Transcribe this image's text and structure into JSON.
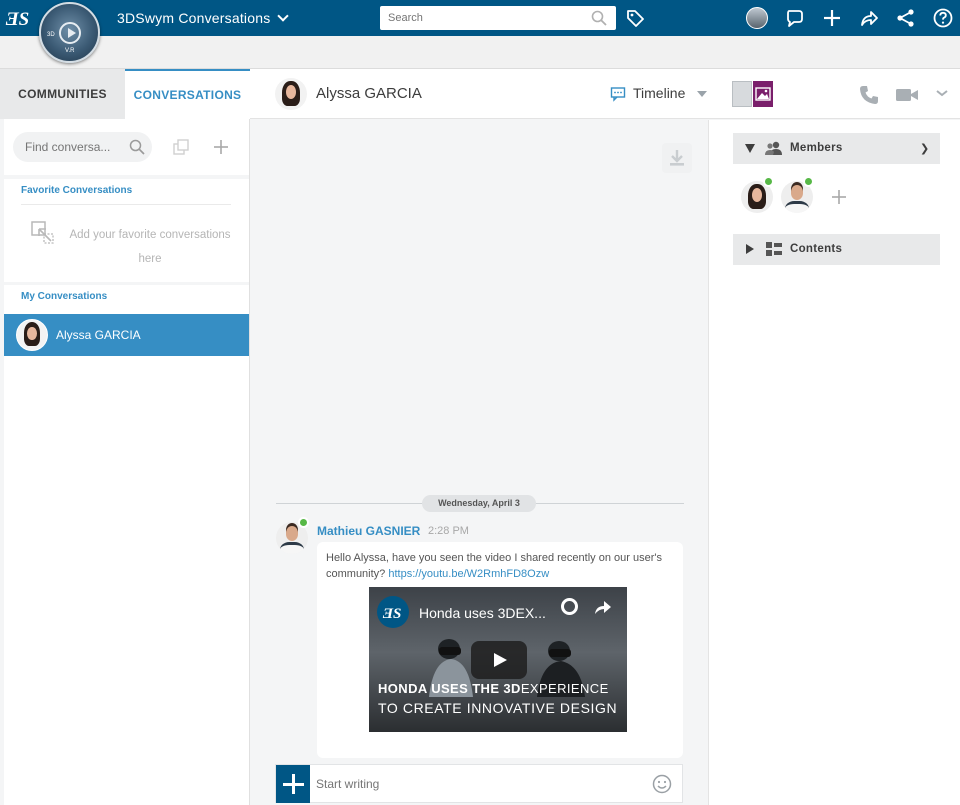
{
  "topbar": {
    "app_title": "3DSwym",
    "app_subtitle": "Conversations",
    "search_placeholder": "Search",
    "compass_label": "3D",
    "compass_version": "V.R"
  },
  "left_panel": {
    "tabs": [
      {
        "label": "COMMUNITIES",
        "active": false
      },
      {
        "label": "CONVERSATIONS",
        "active": true
      }
    ],
    "find_placeholder": "Find conversa...",
    "favorites": {
      "title": "Favorite Conversations",
      "empty_text": "Add your favorite conversations here"
    },
    "my_conversations": {
      "title": "My Conversations",
      "items": [
        {
          "name": "Alyssa GARCIA",
          "selected": true
        }
      ]
    }
  },
  "header": {
    "contact_name": "Alyssa GARCIA",
    "view_label": "Timeline"
  },
  "chat": {
    "date_separator": "Wednesday, April 3",
    "messages": [
      {
        "author": "Mathieu GASNIER",
        "time": "2:28 PM",
        "text": "Hello Alyssa, have you seen the video I shared recently on our user's community? ",
        "link": "https://youtu.be/W2RmhFD8Ozw",
        "video": {
          "title": "Honda uses 3DEX...",
          "caption_line1_bold": "HONDA USES THE 3D",
          "caption_line1_rest": "EXPERIENCE",
          "caption_line2": "TO CREATE INNOVATIVE DESIGN"
        }
      }
    ],
    "composer_placeholder": "Start writing"
  },
  "right_panel": {
    "members_label": "Members",
    "contents_label": "Contents",
    "members_count": 2
  },
  "colors": {
    "brand_blue": "#005685",
    "accent_blue": "#368ec4",
    "online_green": "#57b847",
    "media_purple": "#7a1f6b"
  },
  "icons": [
    "ds-logo-icon",
    "compass-icon",
    "search-icon",
    "tag-icon",
    "user-avatar",
    "chat-bubble-icon",
    "plus-icon",
    "share-icon",
    "network-icon",
    "help-icon",
    "download-icon",
    "phone-icon",
    "video-icon",
    "chevron-down-icon",
    "emoji-icon",
    "members-icon",
    "contents-icon"
  ]
}
